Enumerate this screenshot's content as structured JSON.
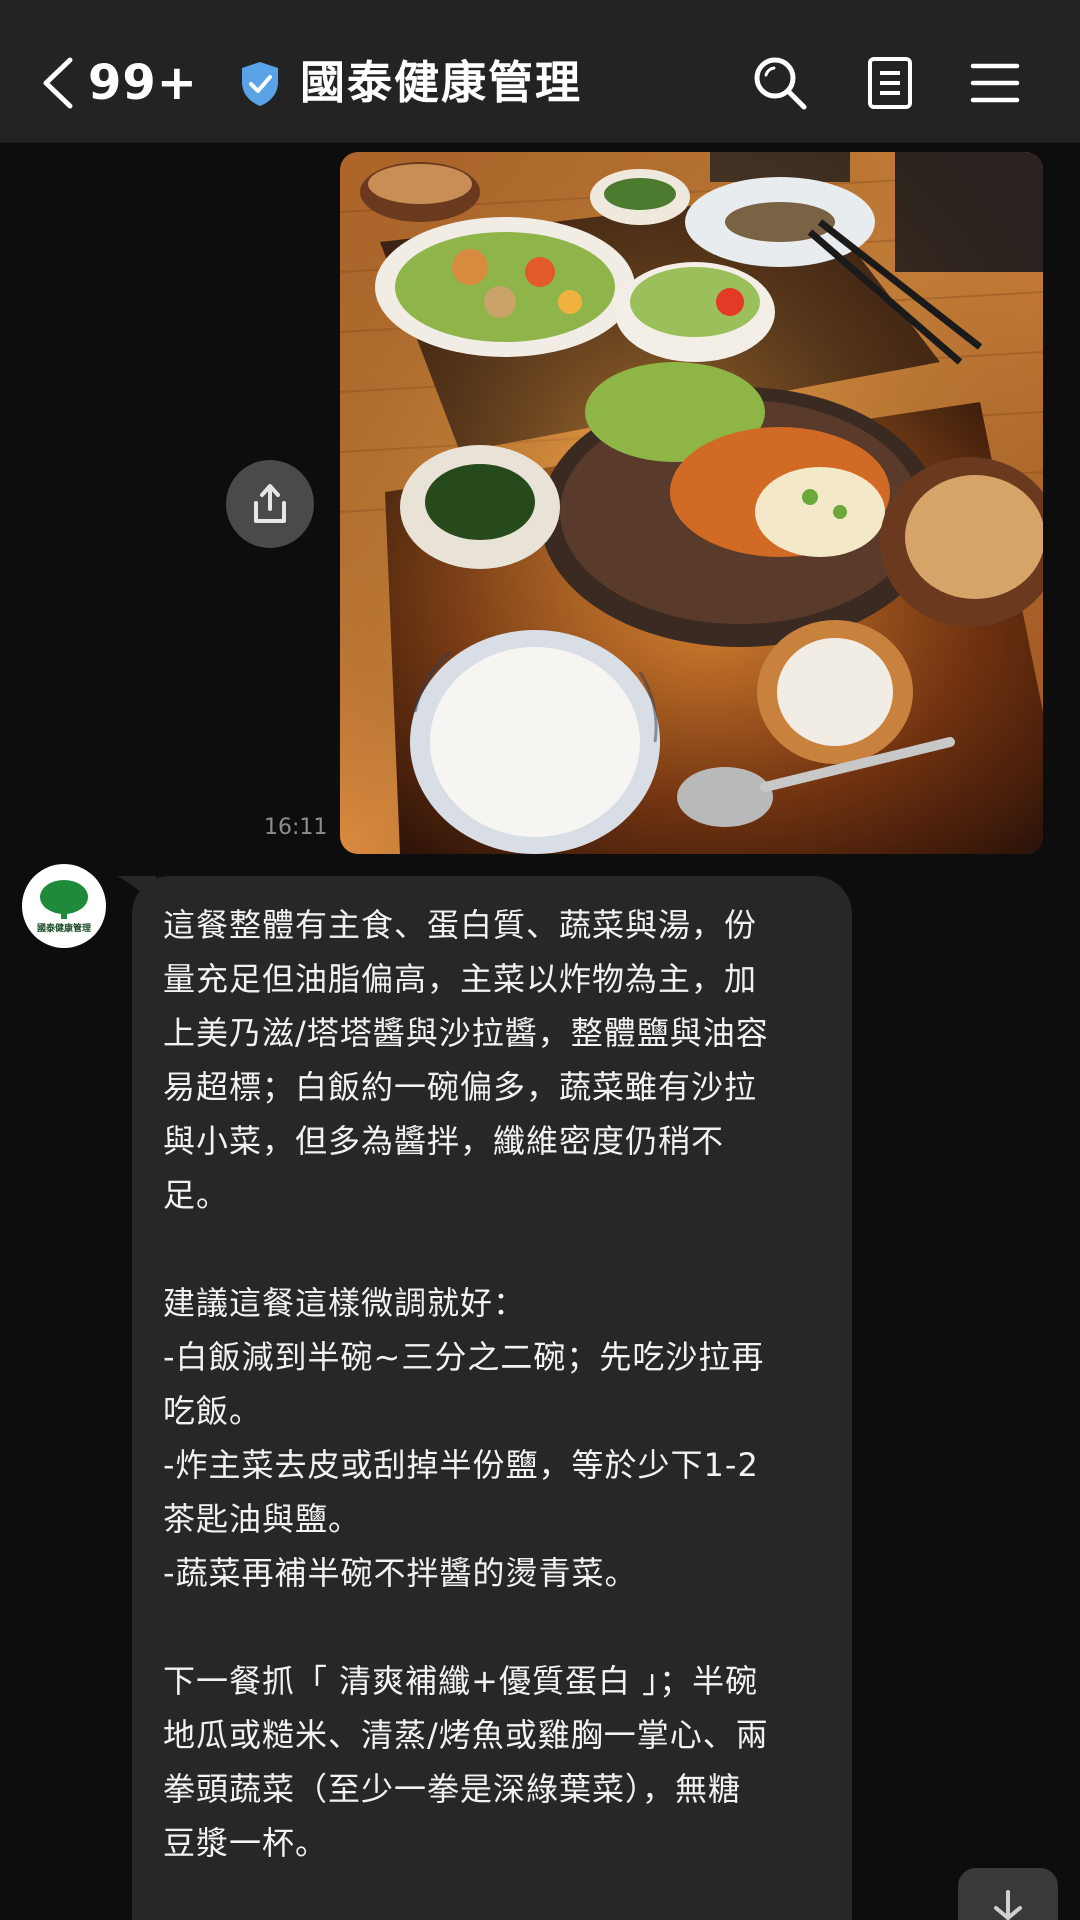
{
  "header": {
    "back_icon": "chevron-left-icon",
    "unread_count": "99+",
    "verified_icon": "shield-check-icon",
    "title": "國泰健康管理",
    "search_icon": "search-icon",
    "notes_icon": "notes-icon",
    "menu_icon": "hamburger-menu-icon"
  },
  "chat": {
    "sent_photo": {
      "alt": "meal-photo",
      "time": "16:11",
      "share_icon": "share-icon"
    },
    "reply": {
      "avatar_label": "國泰健康管理",
      "lines": [
        "這餐整體有主食、蛋白質、蔬菜與湯，份",
        "量充足但油脂偏高，主菜以炸物為主，加",
        "上美乃滋/塔塔醬與沙拉醬，整體鹽與油容",
        "易超標；白飯約一碗偏多，蔬菜雖有沙拉",
        "與小菜，但多為醬拌，纖維密度仍稍不",
        "足。",
        "",
        "建議這餐這樣微調就好：",
        "-白飯減到半碗~三分之二碗；先吃沙拉再",
        "吃飯。",
        "-炸主菜去皮或刮掉半份鹽，等於少下1-2",
        "茶匙油與鹽。",
        "-蔬菜再補半碗不拌醬的燙青菜。",
        "",
        "下一餐抓「 清爽補纖+優質蛋白 」；半碗",
        "地瓜或糙米、清蒸/烤魚或雞胸一掌心、兩",
        "拳頭蔬菜（至少一拳是深綠葉菜），無糖",
        "豆漿一杯。"
      ]
    },
    "scroll_down_icon": "arrow-down-icon"
  },
  "colors": {
    "header_bg": "#232323",
    "chat_bg": "#0d0d0d",
    "bubble_bg": "#272727",
    "verified_blue": "#5aa3e6",
    "avatar_green": "#1f8a3a"
  }
}
